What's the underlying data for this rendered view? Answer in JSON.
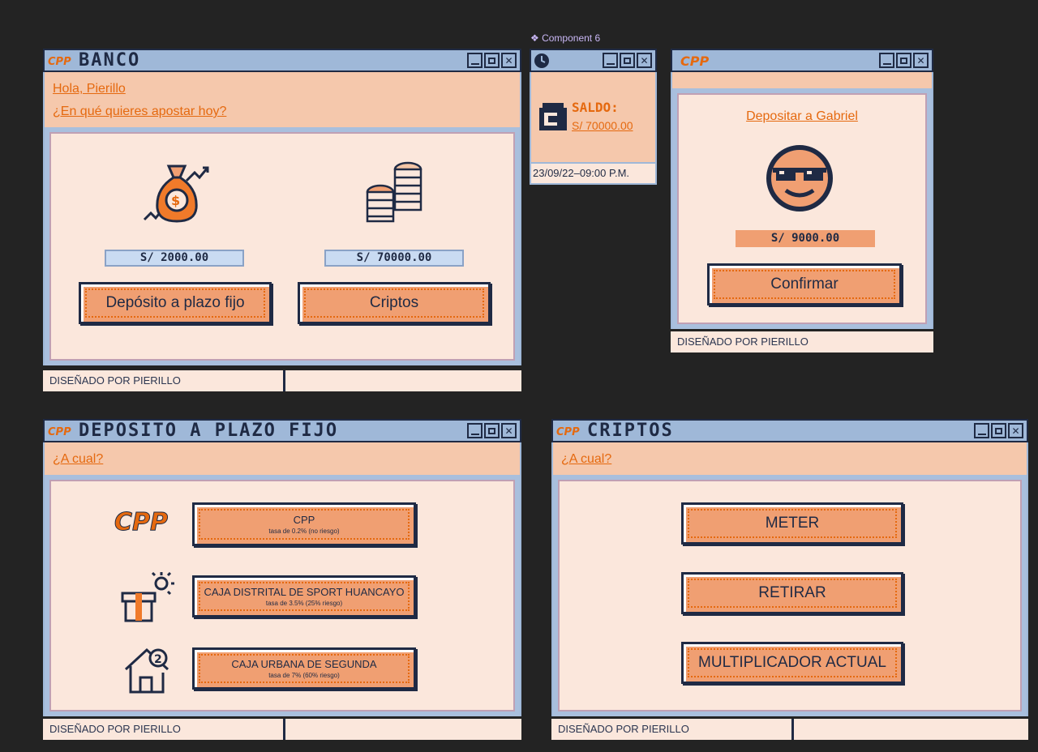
{
  "component_label": "❖ Component 6",
  "logo_text": "CPP",
  "banco": {
    "title": "BANCO",
    "greeting": "Hola, Pierillo",
    "question": "¿En qué quieres apostar hoy?",
    "deposit_amount": "S/ 2000.00",
    "crypto_amount": "S/ 70000.00",
    "deposit_button": "Depósito a plazo fijo",
    "crypto_button": "Criptos",
    "footer": "DISEÑADO POR PIERILLO"
  },
  "saldo": {
    "label": "SALDO:",
    "amount": "S/ 70000.00",
    "datetime": "23/09/22–09:00 P.M."
  },
  "transfer": {
    "recipient_link": "Depositar a Gabriel",
    "amount": "S/ 9000.00",
    "confirm_button": "Confirmar",
    "footer": "DISEÑADO POR PIERILLO"
  },
  "plazo": {
    "title": "DEPOSITO A PLAZO FIJO",
    "question": "¿A cual?",
    "options": [
      {
        "name": "CPP",
        "rate": "tasa de 0.2% (no riesgo)"
      },
      {
        "name": "CAJA DISTRITAL DE SPORT HUANCAYO",
        "rate": "tasa de 3.5% (25% riesgo)"
      },
      {
        "name": "CAJA URBANA DE SEGUNDA",
        "rate": "tasa de 7% (60% riesgo)"
      }
    ],
    "footer": "DISEÑADO POR PIERILLO"
  },
  "criptos": {
    "title": "CRIPTOS",
    "question": "¿A cual?",
    "buttons": [
      "METER",
      "RETIRAR",
      "MULTIPLICADOR ACTUAL"
    ],
    "footer": "DISEÑADO POR PIERILLO"
  },
  "colors": {
    "background": "#232323",
    "titlebar": "#9fb8d8",
    "accent_orange": "#e5690f",
    "button_fill": "#f09f72",
    "panel_peach": "#fbe7dc",
    "greeting_band": "#f5c8ac",
    "navy": "#1f2a44"
  }
}
